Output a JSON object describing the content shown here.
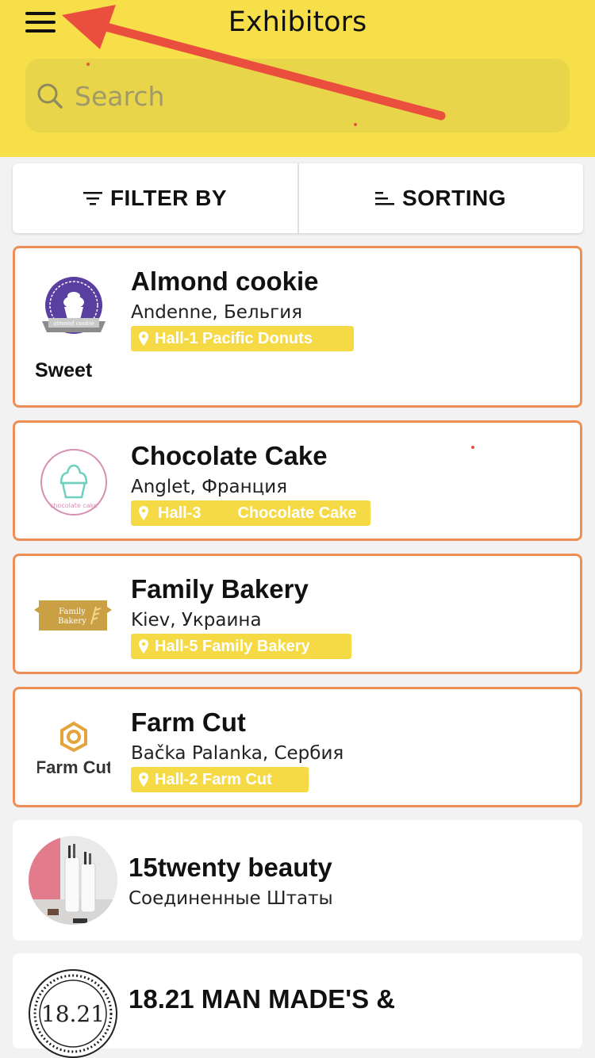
{
  "header": {
    "title": "Exhibitors",
    "search_placeholder": "Search"
  },
  "toolbar": {
    "filter_label": "FILTER BY",
    "sort_label": "SORTING"
  },
  "exhibitors": [
    {
      "name": "Almond cookie",
      "location": "Andenne, Бельгия",
      "hall": "Hall-1 Pacific Donuts",
      "category": "Sweet",
      "logo_text": "almond cookie"
    },
    {
      "name": "Chocolate Cake",
      "location": "Anglet, Франция",
      "hall": "Hall-3",
      "booth": "Chocolate Cake",
      "logo_text": "chocolate cake"
    },
    {
      "name": "Family Bakery",
      "location": "Kiev, Украина",
      "hall": "Hall-5 Family Bakery",
      "logo_text_1": "Family",
      "logo_text_2": "Bakery"
    },
    {
      "name": "Farm Cut",
      "location": "Bačka Palanka, Сербия",
      "hall": "Hall-2 Farm Cut",
      "logo_text": "Farm Cut"
    },
    {
      "name": "15twenty beauty",
      "location": "Соединенные Штаты"
    },
    {
      "name": "18.21 MAN MADE'S &",
      "logo_text": "18.21"
    }
  ],
  "colors": {
    "header_bg": "#f7df4a",
    "card_border": "#ef8f55",
    "tag_bg": "#f6da45",
    "annotation_arrow": "#e5533f"
  }
}
